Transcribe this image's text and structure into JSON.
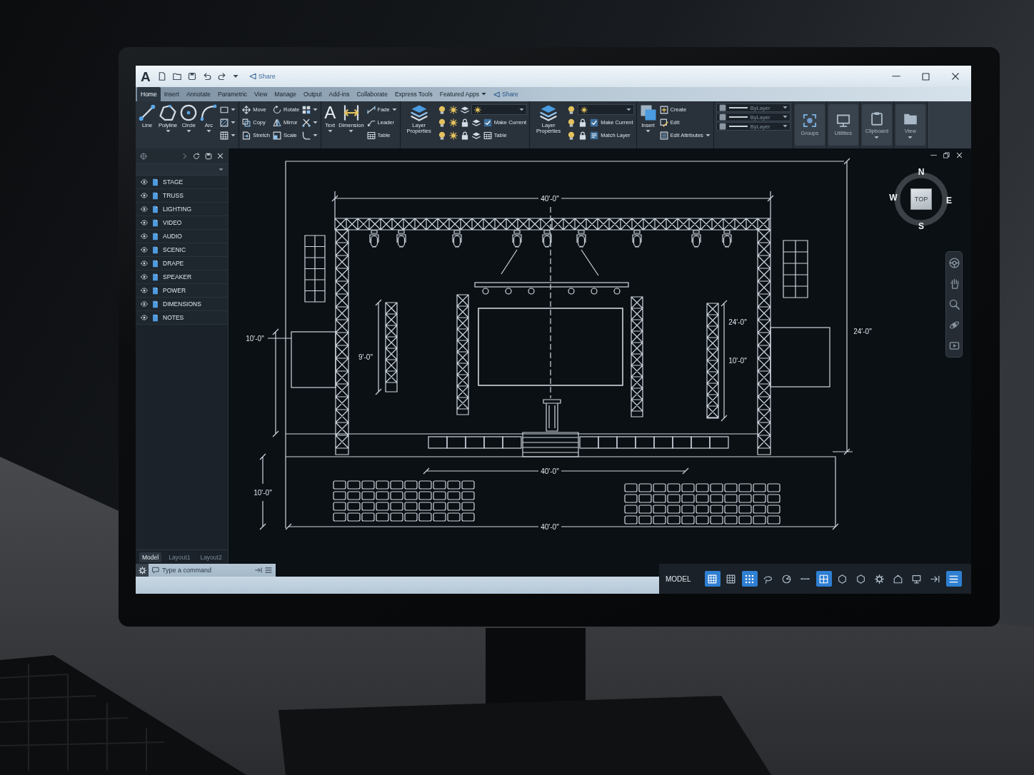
{
  "title_bar": {
    "logo": "A",
    "share": "Share"
  },
  "ribbon_tabs": [
    {
      "label": "Home",
      "selected": true,
      "menu": false
    },
    {
      "label": "Insert",
      "selected": false,
      "menu": false
    },
    {
      "label": "Annotate",
      "selected": false,
      "menu": false
    },
    {
      "label": "Parametric",
      "selected": false,
      "menu": false
    },
    {
      "label": "View",
      "selected": false,
      "menu": false
    },
    {
      "label": "Manage",
      "selected": false,
      "menu": false
    },
    {
      "label": "Output",
      "selected": false,
      "menu": false
    },
    {
      "label": "Add-ins",
      "selected": false,
      "menu": false
    },
    {
      "label": "Collaborate",
      "selected": false,
      "menu": false
    },
    {
      "label": "Express Tools",
      "selected": false,
      "menu": false
    },
    {
      "label": "Featured Apps",
      "selected": false,
      "menu": true
    }
  ],
  "ribbon_share": "Share",
  "ribbon_panels": [
    {
      "kind": "tools",
      "columns": [
        [
          {
            "kind": "large",
            "label": "Line",
            "caret": false
          }
        ],
        [
          {
            "kind": "large",
            "label": "Polyline",
            "caret": true
          }
        ],
        [
          {
            "kind": "large",
            "label": "Circle",
            "caret": true
          }
        ],
        [
          {
            "kind": "large",
            "label": "Arc",
            "caret": true
          }
        ],
        [
          {
            "kind": "icon",
            "caret": true
          },
          {
            "kind": "icon",
            "caret": true
          },
          {
            "kind": "icon",
            "caret": true
          }
        ]
      ]
    },
    {
      "kind": "tools",
      "columns": [
        [
          {
            "kind": "small",
            "label": "Move",
            "caret": false
          },
          {
            "kind": "small",
            "label": "Copy",
            "caret": false
          },
          {
            "kind": "small",
            "label": "Stretch",
            "caret": false
          }
        ],
        [
          {
            "kind": "small",
            "label": "Rotate",
            "caret": false
          },
          {
            "kind": "small",
            "label": "Mirror",
            "caret": false
          },
          {
            "kind": "small",
            "label": "Scale",
            "caret": false
          }
        ],
        [
          {
            "kind": "icon",
            "caret": true
          },
          {
            "kind": "icon",
            "caret": true
          },
          {
            "kind": "icon",
            "caret": true
          }
        ]
      ]
    },
    {
      "kind": "tools",
      "columns": [
        [
          {
            "kind": "large",
            "label": "Text",
            "glyph": "A",
            "caret": true
          }
        ],
        [
          {
            "kind": "large",
            "label": "Dimension",
            "caret": true
          }
        ],
        [
          {
            "kind": "small",
            "label": "Fade",
            "caret": true
          },
          {
            "kind": "small",
            "label": "Leader",
            "caret": false
          },
          {
            "kind": "small",
            "label": "Table",
            "caret": false
          }
        ]
      ]
    },
    {
      "kind": "tools",
      "columns": [
        [
          {
            "kind": "large",
            "label": "Layer Properties",
            "caret": false
          }
        ],
        [
          {
            "kind": "row",
            "items": [
              {
                "kind": "icon",
                "caret": false
              },
              {
                "kind": "icon",
                "caret": false
              },
              {
                "kind": "icon",
                "caret": false
              },
              {
                "kind": "select"
              }
            ]
          },
          {
            "kind": "row",
            "items": [
              {
                "kind": "icon",
                "caret": false
              },
              {
                "kind": "icon",
                "caret": false
              },
              {
                "kind": "icon",
                "caret": false
              },
              {
                "kind": "icon",
                "caret": false
              },
              {
                "kind": "small",
                "label": "Make Current",
                "caret": false
              }
            ]
          },
          {
            "kind": "row",
            "items": [
              {
                "kind": "icon",
                "caret": false
              },
              {
                "kind": "icon",
                "caret": false
              },
              {
                "kind": "icon",
                "caret": false
              },
              {
                "kind": "icon",
                "caret": false
              },
              {
                "kind": "small",
                "label": "Table",
                "caret": false
              }
            ]
          }
        ]
      ]
    },
    {
      "kind": "tools",
      "columns": [
        [
          {
            "kind": "large",
            "label": "Layer Properties",
            "caret": false
          }
        ],
        [
          {
            "kind": "row",
            "items": [
              {
                "kind": "icon",
                "caret": false
              },
              {
                "kind": "select"
              }
            ]
          },
          {
            "kind": "row",
            "items": [
              {
                "kind": "icon",
                "caret": false
              },
              {
                "kind": "icon",
                "caret": false
              },
              {
                "kind": "small",
                "label": "Make Current",
                "caret": false
              }
            ]
          },
          {
            "kind": "row",
            "items": [
              {
                "kind": "icon",
                "caret": false
              },
              {
                "kind": "icon",
                "caret": false
              },
              {
                "kind": "small",
                "label": "Match Layer",
                "caret": false
              }
            ]
          }
        ]
      ]
    },
    {
      "kind": "tools",
      "columns": [
        [
          {
            "kind": "large",
            "label": "Insert",
            "caret": true
          }
        ],
        [
          {
            "kind": "small",
            "label": "Create",
            "caret": false
          },
          {
            "kind": "small",
            "label": "Edit",
            "caret": false
          },
          {
            "kind": "small",
            "label": "Edit Attributes",
            "caret": true
          }
        ]
      ]
    },
    {
      "kind": "tools",
      "columns": [
        [
          {
            "kind": "line_select",
            "value": "ByLayer"
          },
          {
            "kind": "line_select",
            "value": "ByLayer"
          },
          {
            "kind": "line_select",
            "value": "ByLayer"
          }
        ]
      ]
    },
    {
      "kind": "collapsed",
      "label": "Groups",
      "caret": false
    },
    {
      "kind": "collapsed",
      "label": "Utilities",
      "caret": false
    },
    {
      "kind": "collapsed",
      "label": "Clipboard",
      "caret": true
    },
    {
      "kind": "collapsed",
      "label": "View",
      "caret": true
    }
  ],
  "layers_palette": {
    "layers": [
      {
        "name": "STAGE",
        "visible": true
      },
      {
        "name": "TRUSS",
        "visible": true
      },
      {
        "name": "LIGHTING",
        "visible": true
      },
      {
        "name": "VIDEO",
        "visible": true
      },
      {
        "name": "AUDIO",
        "visible": true
      },
      {
        "name": "SCENIC",
        "visible": true
      },
      {
        "name": "DRAPE",
        "visible": true
      },
      {
        "name": "SPEAKER",
        "visible": true
      },
      {
        "name": "POWER",
        "visible": true
      },
      {
        "name": "DIMENSIONS",
        "visible": true
      },
      {
        "name": "NOTES",
        "visible": true
      }
    ]
  },
  "layout_tabs": [
    {
      "label": "Model",
      "selected": true
    },
    {
      "label": "Layout1",
      "selected": false
    },
    {
      "label": "Layout2",
      "selected": false
    }
  ],
  "drawing": {
    "dimension_labels": [
      "40'-0\"",
      "10'-0\"",
      "9'-0\"",
      "24'-0\"",
      "10'-0\"",
      "24'-0\"",
      "10'-0\"",
      "40'-0\"",
      "40'-0\""
    ]
  },
  "view_cube": {
    "face": "TOP",
    "north": "N",
    "east": "E",
    "south": "S",
    "west": "W"
  },
  "command_line": {
    "placeholder": "Type a command"
  },
  "status_bar": {
    "mode": "MODEL",
    "toggles": [
      {
        "on": true
      },
      {
        "on": false
      },
      {
        "on": true
      },
      {
        "on": false
      },
      {
        "on": false
      },
      {
        "on": false
      },
      {
        "on": true
      },
      {
        "on": false
      },
      {
        "on": false
      },
      {
        "on": false
      },
      {
        "on": false
      },
      {
        "on": false
      },
      {
        "on": false
      },
      {
        "on": true
      }
    ]
  }
}
